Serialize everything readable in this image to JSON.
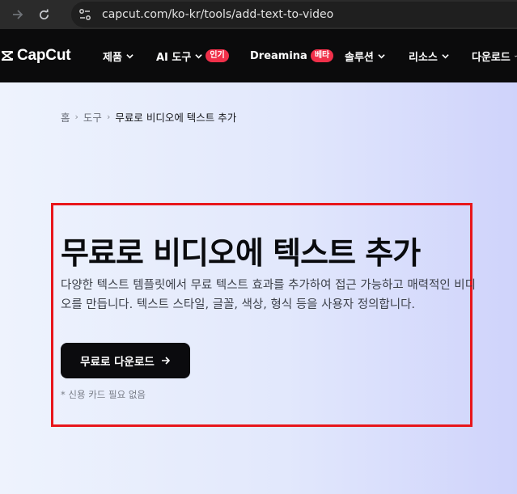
{
  "browser": {
    "url": "capcut.com/ko-kr/tools/add-text-to-video"
  },
  "nav": {
    "logo_text": "CapCut",
    "items": [
      {
        "label": "제품",
        "has_chevron": true
      },
      {
        "label": "AI 도구",
        "has_chevron": true,
        "badge": "인기"
      },
      {
        "label": "Dreamina",
        "has_chevron": false,
        "badge": "베타"
      },
      {
        "label": "솔루션",
        "has_chevron": true
      },
      {
        "label": "리소스",
        "has_chevron": true
      },
      {
        "label": "다운로드",
        "has_chevron": true
      }
    ],
    "badge_color": "#f0304a"
  },
  "breadcrumb": {
    "home": "홈",
    "tools": "도구",
    "current": "무료로 비디오에 텍스트 추가"
  },
  "hero": {
    "title": "무료로 비디오에 텍스트 추가",
    "description": "다양한 텍스트 템플릿에서 무료 텍스트 효과를 추가하여 접근 가능하고 매력적인 비디오를 만듭니다. 텍스트 스타일, 글꼴, 색상, 형식 등을 사용자 정의합니다.",
    "cta_label": "무료로 다운로드",
    "note": "* 신용 카드 필요 없음"
  },
  "colors": {
    "highlight": "#e8161b",
    "nav_bg": "#0b0b0c",
    "cta_bg": "#0b0b0e"
  }
}
